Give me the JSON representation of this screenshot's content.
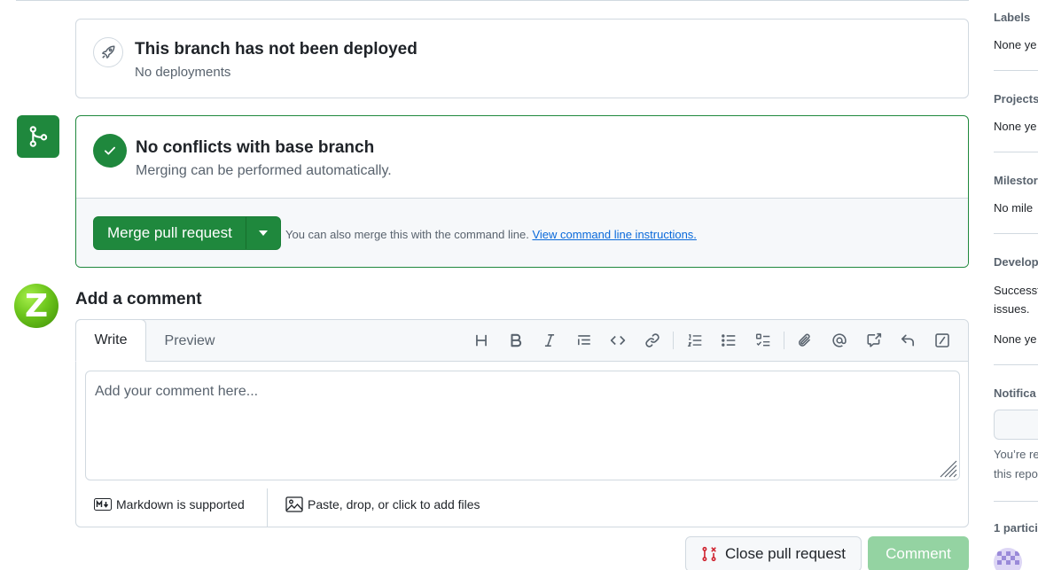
{
  "deployment": {
    "title": "This branch has not been deployed",
    "subtitle": "No deployments"
  },
  "merge": {
    "title": "No conflicts with base branch",
    "subtitle": "Merging can be performed automatically.",
    "merge_button": "Merge pull request",
    "hint_text": "You can also merge this with the command line.",
    "hint_link": "View command line instructions."
  },
  "comment": {
    "avatar_letter": "Z",
    "heading": "Add a comment",
    "tabs": {
      "write": "Write",
      "preview": "Preview"
    },
    "placeholder": "Add your comment here...",
    "markdown_note": "Markdown is supported",
    "files_note": "Paste, drop, or click to add files",
    "toolbar_icons": [
      "heading-icon",
      "bold-icon",
      "italic-icon",
      "quote-icon",
      "code-icon",
      "link-icon",
      "numbered-list-icon",
      "unordered-list-icon",
      "task-list-icon",
      "attach-icon",
      "mention-icon",
      "cross-reference-icon",
      "reply-icon",
      "slash-commands-icon"
    ]
  },
  "actions": {
    "close_pr": "Close pull request",
    "comment": "Comment"
  },
  "sidebar": {
    "labels_heading": "Labels",
    "labels_value": "None ye",
    "projects_heading": "Projects",
    "projects_value": "None ye",
    "milestone_heading": "Milestor",
    "milestone_value": "No mile",
    "development_heading": "Develop",
    "development_text_1": "Successf",
    "development_text_2": "issues.",
    "development_value": "None ye",
    "notifications_heading": "Notifica",
    "notifications_text_1": "You’re re",
    "notifications_text_2": "this repo",
    "participants_heading": "1 partici"
  },
  "colors": {
    "success": "#1f883d",
    "link": "#0969da",
    "border": "#d1d9e0",
    "muted": "#59636e",
    "danger": "#cf222e",
    "comment_disabled": "#94d3a2"
  }
}
